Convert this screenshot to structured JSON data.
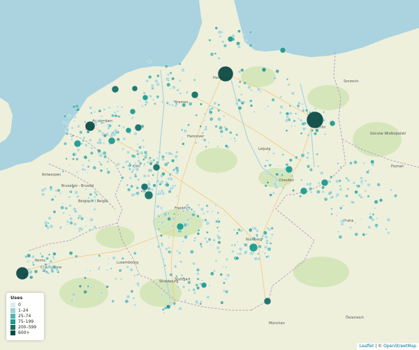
{
  "legend": {
    "title": "Uses",
    "items": [
      {
        "label": "0",
        "color": "#d9ecee"
      },
      {
        "label": "1–24",
        "color": "#9fd3d6"
      },
      {
        "label": "25–74",
        "color": "#4fb3b0"
      },
      {
        "label": "75–199",
        "color": "#1f9a8d"
      },
      {
        "label": "200–599",
        "color": "#157068"
      },
      {
        "label": "600+",
        "color": "#0c4a44"
      }
    ]
  },
  "attribution": {
    "leaflet": "Leaflet",
    "separator": " | © ",
    "osm": "OpenStreetMap"
  },
  "cities": [
    {
      "name": "Hamburg"
    },
    {
      "name": "Bremen"
    },
    {
      "name": "Berlin"
    },
    {
      "name": "Szczecin"
    },
    {
      "name": "Hannover"
    },
    {
      "name": "Amsterdam"
    },
    {
      "name": "Antwerpen"
    },
    {
      "name": "Bruxelles - Brussel"
    },
    {
      "name": "Belgique / België"
    },
    {
      "name": "Luxembourg"
    },
    {
      "name": "Frankfurt"
    },
    {
      "name": "Praha"
    },
    {
      "name": "Nürnberg"
    },
    {
      "name": "Stuttgart"
    },
    {
      "name": "Strasbourg"
    },
    {
      "name": "München"
    },
    {
      "name": "Österreich"
    },
    {
      "name": "Leipzig"
    },
    {
      "name": "Dresden"
    },
    {
      "name": "Köln"
    },
    {
      "name": "Reims"
    },
    {
      "name": "Champagne"
    },
    {
      "name": "Gorzów Wielkopolski"
    },
    {
      "name": "Poznań"
    }
  ]
}
